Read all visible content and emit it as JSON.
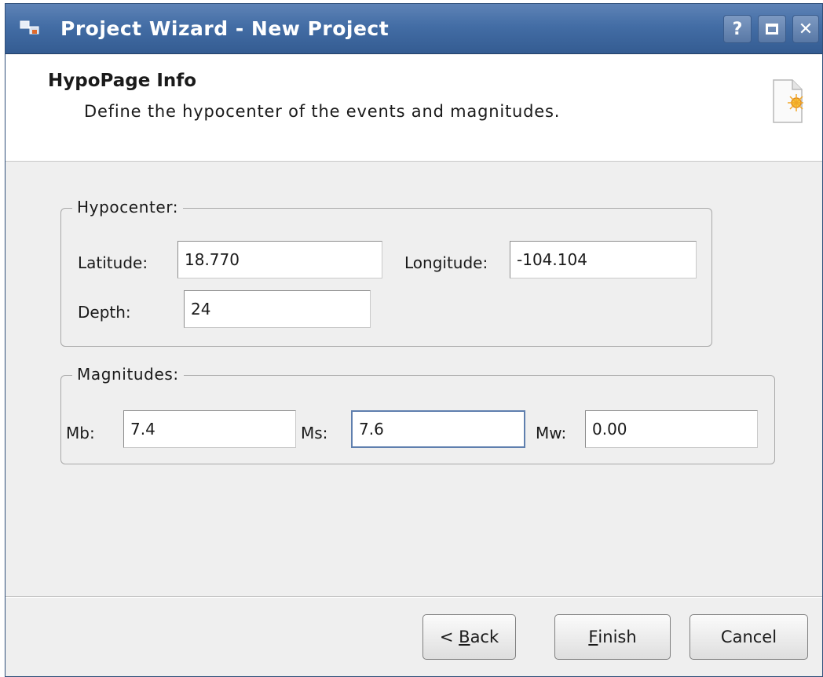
{
  "window": {
    "title": "Project Wizard - New Project",
    "controls": {
      "help": "?",
      "close": "✕"
    }
  },
  "header": {
    "title": "HypoPage Info",
    "subtitle": "Define the hypocenter of the events and magnitudes."
  },
  "hypocenter": {
    "legend": "Hypocenter:",
    "latitude_label": "Latitude:",
    "latitude_value": "18.770",
    "longitude_label": "Longitude:",
    "longitude_value": "-104.104",
    "depth_label": "Depth:",
    "depth_value": "24"
  },
  "magnitudes": {
    "legend": "Magnitudes:",
    "mb_label": "Mb:",
    "mb_value": "7.4",
    "ms_label": "Ms:",
    "ms_value": "7.6",
    "mw_label": "Mw:",
    "mw_value": "0.00"
  },
  "buttons": {
    "back_prefix": "< ",
    "back_mnemonic": "B",
    "back_rest": "ack",
    "finish_mnemonic": "F",
    "finish_rest": "inish",
    "cancel": "Cancel"
  },
  "colors": {
    "titlebar": "#436da5",
    "dialog_bg": "#efefef",
    "focus_border": "#5f7fae"
  }
}
